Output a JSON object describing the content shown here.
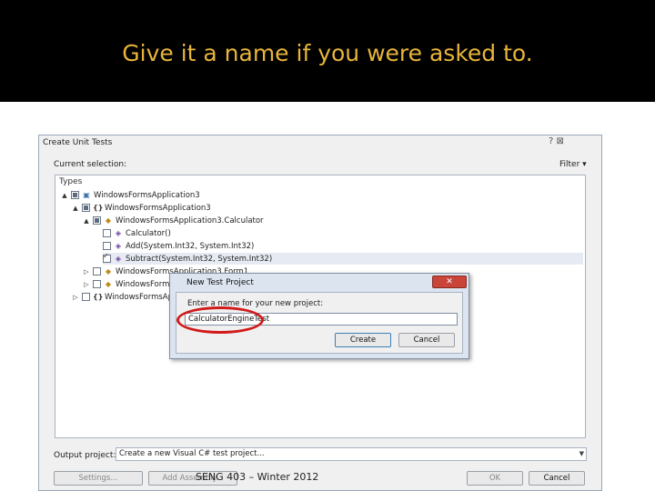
{
  "slide": {
    "title": "Give it a name if you were asked to.",
    "footer": "SENG 403 – Winter 2012"
  },
  "colors": {
    "banner": "#000000",
    "title": "#e8b53a",
    "highlight": "#d11a1a"
  },
  "create_dialog": {
    "title": "Create Unit Tests",
    "help_icons": "? ⊠",
    "current_selection_label": "Current selection:",
    "filter_label": "Filter ▾",
    "types_header": "Types",
    "tree": [
      {
        "label": "WindowsFormsApplication3",
        "icon": "project-icon",
        "expand": "▲",
        "check": "filled"
      },
      {
        "label": "WindowsFormsApplication3",
        "icon": "namespace-icon",
        "expand": "▲",
        "check": "filled"
      },
      {
        "label": "WindowsFormsApplication3.Calculator",
        "icon": "class-icon",
        "expand": "▲",
        "check": "filled"
      },
      {
        "label": "Calculator()",
        "icon": "method-icon",
        "expand": "",
        "check": "empty"
      },
      {
        "label": "Add(System.Int32, System.Int32)",
        "icon": "method-icon",
        "expand": "",
        "check": "empty"
      },
      {
        "label": "Subtract(System.Int32, System.Int32)",
        "icon": "method-icon",
        "expand": "",
        "check": "checked"
      },
      {
        "label": "WindowsFormsApplication3.Form1",
        "icon": "class-icon",
        "expand": "▷",
        "check": "empty"
      },
      {
        "label": "WindowsFormsApplication3.Program",
        "icon": "class-icon",
        "expand": "▷",
        "check": "empty"
      },
      {
        "label": "WindowsFormsApplication3.Properties",
        "icon": "namespace-icon",
        "expand": "▷",
        "check": "empty"
      }
    ],
    "output_project_label": "Output project:",
    "output_project_value": "Create a new Visual C# test project...",
    "settings_button": "Settings...",
    "add_assembly_button": "Add Assembly...",
    "ok_button": "OK",
    "cancel_button": "Cancel"
  },
  "new_test_dialog": {
    "title": "New Test Project",
    "close_label": "✕",
    "prompt": "Enter a name for your new project:",
    "input_value": "CalculatorEngineTest",
    "create_button": "Create",
    "cancel_button": "Cancel"
  }
}
